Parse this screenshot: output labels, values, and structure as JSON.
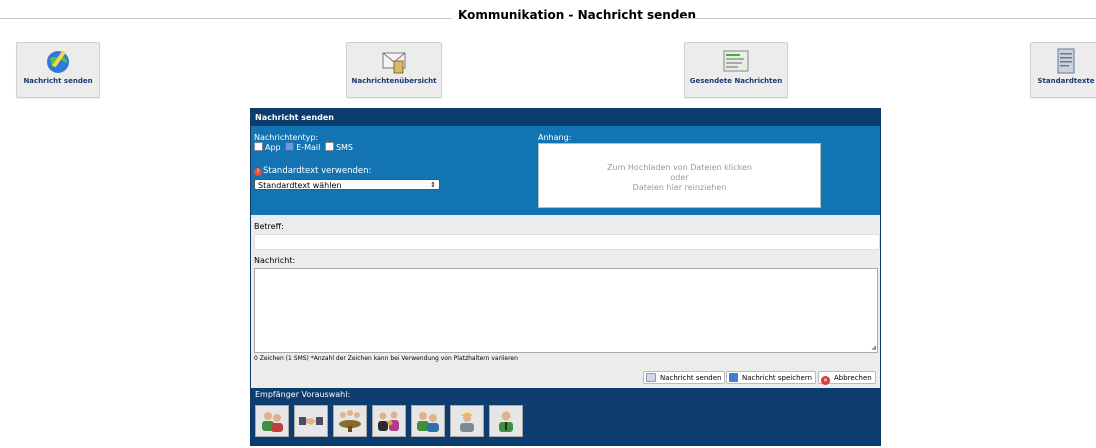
{
  "page": {
    "title": "Kommunikation - Nachricht senden"
  },
  "nav": {
    "send": "Nachricht senden",
    "overview": "Nachrichtenübersicht",
    "sent": "Gesendete Nachrichten",
    "templates": "Standardtexte"
  },
  "form": {
    "header": "Nachricht senden",
    "message_type_label": "Nachrichtentyp:",
    "types": [
      {
        "label": "App",
        "checked": false
      },
      {
        "label": "E-Mail",
        "checked": true
      },
      {
        "label": "SMS",
        "checked": false
      }
    ],
    "template_label": "Standardtext verwenden:",
    "template_selected": "Standardtext wählen",
    "attachment_label": "Anhang:",
    "drop_line1": "Zum Hochladen von Dateien klicken",
    "drop_line2": "oder",
    "drop_line3": "Dateien hier reinziehen",
    "subject_label": "Betreff:",
    "subject_value": "",
    "message_label": "Nachricht:",
    "message_value": "",
    "char_note": "0 Zeichen (1 SMS) *Anzahl der Zeichen kann bei Verwendung von Platzhaltern variieren",
    "send_label": "Nachricht senden",
    "save_label": "Nachricht speichern",
    "cancel_label": "Abbrechen",
    "recipients_label": "Empfänger Vorauswahl:"
  },
  "colors": {
    "header_dark": "#0c3d6e",
    "header_blue": "#1374b4",
    "nav_text": "#1b3a72"
  }
}
